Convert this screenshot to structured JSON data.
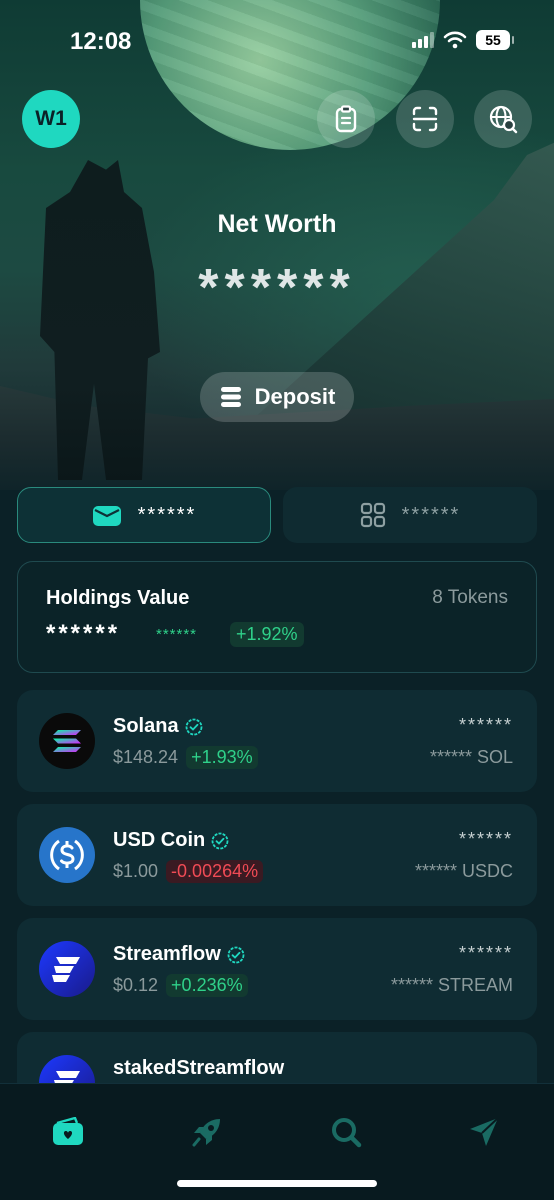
{
  "status_bar": {
    "time": "12:08",
    "battery": "55"
  },
  "header": {
    "wallet_label": "W1",
    "icons": [
      "clipboard-icon",
      "scan-icon",
      "globe-search-icon"
    ]
  },
  "net_worth": {
    "title": "Net Worth",
    "value": "******"
  },
  "deposit": {
    "label": "Deposit"
  },
  "tabs": [
    {
      "label": "******",
      "icon": "wallet-icon",
      "active": true
    },
    {
      "label": "******",
      "icon": "grid-icon",
      "active": false
    }
  ],
  "holdings": {
    "title": "Holdings Value",
    "count": "8 Tokens",
    "value": "******",
    "change": "******",
    "pct": "+1.92%"
  },
  "tokens": [
    {
      "name": "Solana",
      "price": "$148.24",
      "pct": "+1.93%",
      "direction": "up",
      "balance": "******",
      "amount": "****** SOL"
    },
    {
      "name": "USD Coin",
      "price": "$1.00",
      "pct": "-0.00264%",
      "direction": "down",
      "balance": "******",
      "amount": "****** USDC"
    },
    {
      "name": "Streamflow",
      "price": "$0.12",
      "pct": "+0.236%",
      "direction": "up",
      "balance": "******",
      "amount": "****** STREAM"
    },
    {
      "name": "stakedStreamflow"
    }
  ],
  "nav": [
    "wallet-icon",
    "rocket-icon",
    "search-icon",
    "send-icon"
  ],
  "colors": {
    "accent": "#1fd8c0",
    "positive": "#2fd18a",
    "negative": "#f04b55",
    "background": "#0b2127"
  }
}
